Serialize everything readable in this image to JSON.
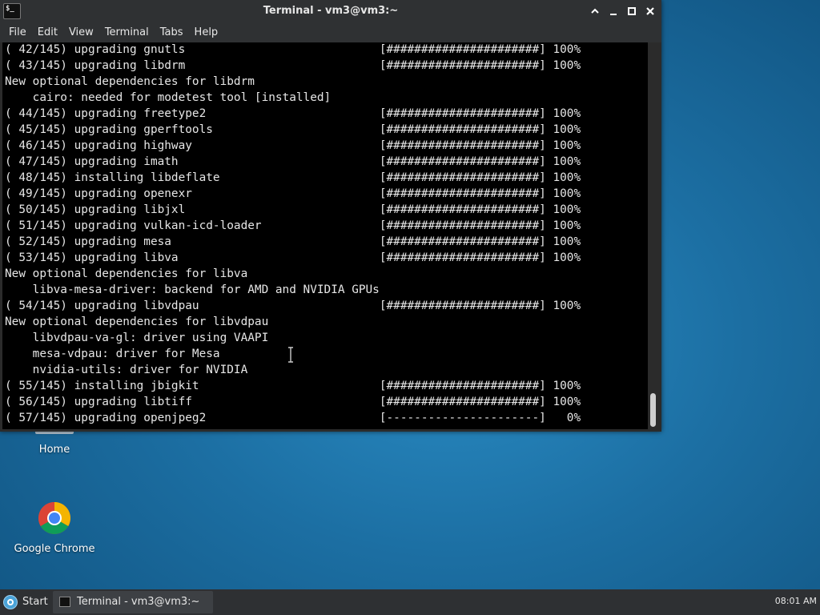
{
  "window": {
    "title": "Terminal - vm3@vm3:~",
    "controls": [
      "maximize-up",
      "minimize",
      "maximize",
      "close"
    ]
  },
  "menu": [
    "File",
    "Edit",
    "View",
    "Terminal",
    "Tabs",
    "Help"
  ],
  "terminal_lines": [
    "( 42/145) upgrading gnutls                            [######################] 100%",
    "( 43/145) upgrading libdrm                            [######################] 100%",
    "New optional dependencies for libdrm",
    "    cairo: needed for modetest tool [installed]",
    "( 44/145) upgrading freetype2                         [######################] 100%",
    "( 45/145) upgrading gperftools                        [######################] 100%",
    "( 46/145) upgrading highway                           [######################] 100%",
    "( 47/145) upgrading imath                             [######################] 100%",
    "( 48/145) installing libdeflate                       [######################] 100%",
    "( 49/145) upgrading openexr                           [######################] 100%",
    "( 50/145) upgrading libjxl                            [######################] 100%",
    "( 51/145) upgrading vulkan-icd-loader                 [######################] 100%",
    "( 52/145) upgrading mesa                              [######################] 100%",
    "( 53/145) upgrading libva                             [######################] 100%",
    "New optional dependencies for libva",
    "    libva-mesa-driver: backend for AMD and NVIDIA GPUs",
    "( 54/145) upgrading libvdpau                          [######################] 100%",
    "New optional dependencies for libvdpau",
    "    libvdpau-va-gl: driver using VAAPI",
    "    mesa-vdpau: driver for Mesa",
    "    nvidia-utils: driver for NVIDIA",
    "( 55/145) installing jbigkit                          [######################] 100%",
    "( 56/145) upgrading libtiff                           [######################] 100%",
    "( 57/145) upgrading openjpeg2                         [----------------------]   0%"
  ],
  "desktop": {
    "home_label": "Home",
    "chrome_label": "Google Chrome"
  },
  "taskbar": {
    "start_label": "Start",
    "task_label": "Terminal - vm3@vm3:~",
    "clock": "08:01 AM"
  },
  "colors": {
    "terminal_bg": "#000000",
    "terminal_fg": "#e6e6e6",
    "chrome_bar": "#2f3133",
    "desktop": "#1c6fa3"
  }
}
